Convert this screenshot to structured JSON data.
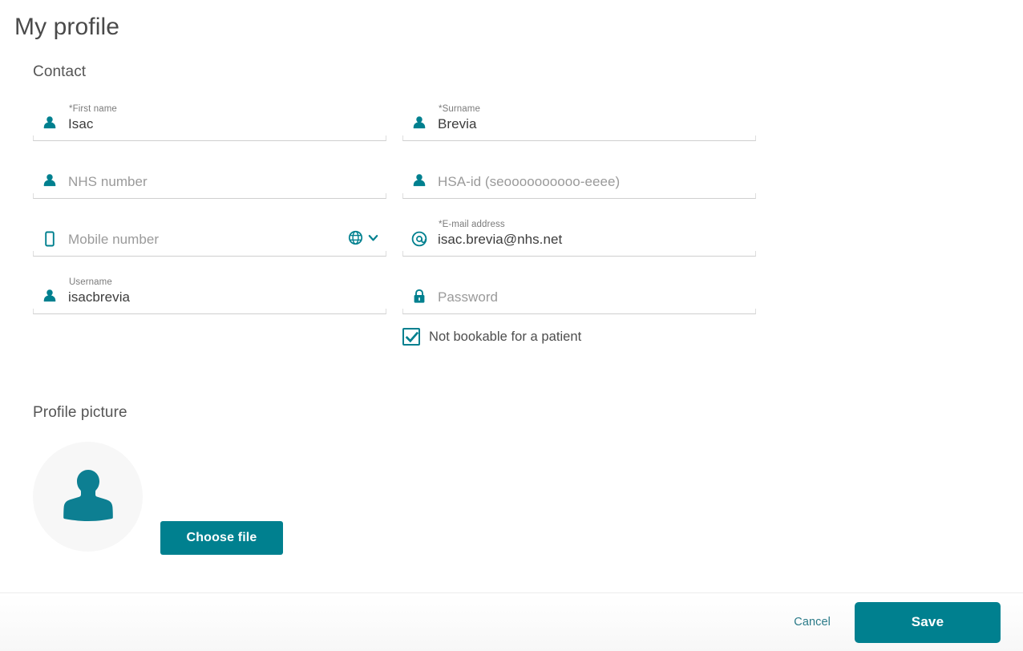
{
  "page": {
    "title": "My profile"
  },
  "theme": {
    "accent": "#00808F",
    "label_gray": "#7B7B7B",
    "value_gray": "#3C3C3C",
    "placeholder_gray": "#9A9A9A",
    "avatar_bg": "#F7F7F7"
  },
  "contact": {
    "heading": "Contact",
    "fields": [
      {
        "name": "first-name",
        "label": "*First name",
        "value": "Isac",
        "placeholder": "",
        "icon": "person-icon",
        "required": true
      },
      {
        "name": "surname",
        "label": "*Surname",
        "value": "Brevia",
        "placeholder": "",
        "icon": "person-icon",
        "required": true
      },
      {
        "name": "nhs-number",
        "label": "",
        "value": "",
        "placeholder": "NHS number",
        "icon": "person-icon",
        "required": false
      },
      {
        "name": "hsa-id",
        "label": "",
        "value": "",
        "placeholder": "HSA-id (seoooooooooo-eeee)",
        "icon": "person-icon",
        "required": false
      },
      {
        "name": "mobile-number",
        "label": "",
        "value": "",
        "placeholder": "Mobile number",
        "icon": "mobile-phone-icon",
        "required": false,
        "country_selector": {
          "icon": "globe-icon",
          "chevron": "chevron-down-icon"
        }
      },
      {
        "name": "email-address",
        "label": "*E-mail address",
        "value": "isac.brevia@nhs.net",
        "placeholder": "",
        "icon": "at-sign-icon",
        "required": true
      },
      {
        "name": "username",
        "label": "Username",
        "value": "isacbrevia",
        "placeholder": "",
        "icon": "person-icon",
        "required": false
      },
      {
        "name": "password",
        "label": "",
        "value": "",
        "placeholder": "Password",
        "icon": "lock-icon",
        "required": false
      }
    ],
    "checkbox": {
      "label": "Not bookable for a patient",
      "checked": true
    }
  },
  "profile_picture": {
    "heading": "Profile picture",
    "avatar_icon": "person-placeholder-icon",
    "choose_file_label": "Choose file"
  },
  "footer": {
    "cancel_label": "Cancel",
    "save_label": "Save"
  }
}
